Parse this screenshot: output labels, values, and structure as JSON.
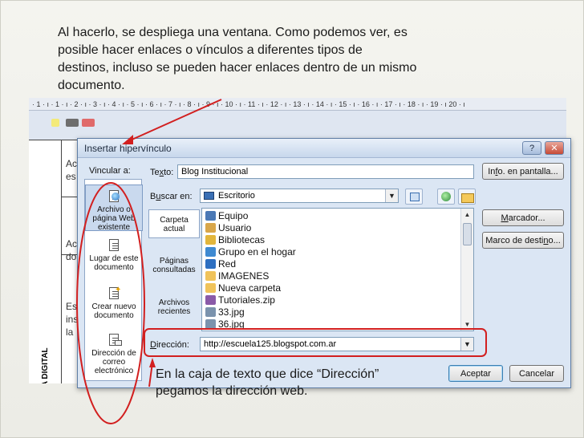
{
  "caption": {
    "line1": "Al hacerlo, se despliega una ventana. Como podemos ver, es",
    "line2": "posible hacer enlaces o vínculos a diferentes tipos de",
    "line3": "destinos, incluso se pueden hacer enlaces dentro de un mismo",
    "line4": "documento."
  },
  "ruler": {
    "text": "· 1 · ı · 1 · ı · 2 · ı · 3 · ı · 4 · ı · 5 · ı · 6 · ı · 7 · ı · 8 · ı · 9 · ı · 10 · ı · 11 · ı · 12 · ı · 13 · ı · 14 · ı · 15 · ı · 16 · ı · 17 · ı · 18 · ı · 19 · ı 20 · ı"
  },
  "document": {
    "vertical_label": "IV. CULTURA DIGITAL",
    "fragments": [
      "Ac",
      "es",
      "Ac",
      "do",
      "Es",
      "ins",
      "la"
    ]
  },
  "dialog": {
    "title": "Insertar hipervínculo",
    "help_glyph": "?",
    "close_glyph": "✕",
    "link_to_label": "Vincular a:",
    "text_label_pre": "Te",
    "text_label_u": "x",
    "text_label_post": "to:",
    "text_value": "Blog Institucional",
    "screen_tip_pre": "In",
    "screen_tip_u": "f",
    "screen_tip_post": "o. en pantalla...",
    "look_in_label_pre": "B",
    "look_in_label_u": "u",
    "look_in_label_post": "scar en:",
    "look_in_value": "Escritorio",
    "combo_arrow": "▼",
    "bookmark_label_pre": "",
    "bookmark_label_u": "M",
    "bookmark_label_post": "arcador...",
    "target_frame_label_pre": "Marco de desti",
    "target_frame_label_u": "n",
    "target_frame_label_post": "o...",
    "address_label_pre": "",
    "address_label_u": "D",
    "address_label_post": "irección:",
    "address_value": "http://escuela125.blogspot.com.ar",
    "accept": "Aceptar",
    "cancel": "Cancelar",
    "link_types": [
      {
        "label": "Archivo o página Web existente"
      },
      {
        "label": "Lugar de este documento"
      },
      {
        "label": "Crear nuevo documento"
      },
      {
        "label": "Dirección de correo electrónico"
      }
    ],
    "look_in_places": [
      {
        "label": "Carpeta actual"
      },
      {
        "label": "Páginas consultadas"
      },
      {
        "label": "Archivos recientes"
      }
    ],
    "files": [
      {
        "name": "Equipo",
        "color": "#4a78b5"
      },
      {
        "name": "Usuario",
        "color": "#d8a64a"
      },
      {
        "name": "Bibliotecas",
        "color": "#e2b63c"
      },
      {
        "name": "Grupo en el hogar",
        "color": "#3f8ad1"
      },
      {
        "name": "Red",
        "color": "#2d6fc1"
      },
      {
        "name": "IMAGENES",
        "color": "#f0c35a"
      },
      {
        "name": "Nueva carpeta",
        "color": "#f0c35a"
      },
      {
        "name": "Tutoriales.zip",
        "color": "#8a5aa8"
      },
      {
        "name": "33.jpg",
        "color": "#7b93ad"
      },
      {
        "name": "36.jpg",
        "color": "#7b93ad"
      }
    ]
  },
  "note": {
    "line1": "En la caja de texto que dice “Dirección”",
    "line2": "pegamos la dirección web."
  },
  "colors": {
    "annotation_red": "#d21f1f",
    "dialog_bg": "#dbe6f4",
    "dialog_border": "#5f7ea5"
  }
}
